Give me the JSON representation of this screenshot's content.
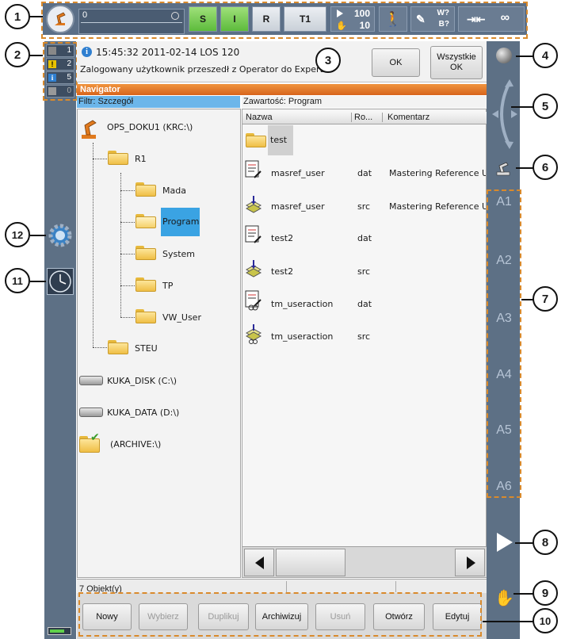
{
  "status_bar": {
    "override_value": "0",
    "btn_s": "S",
    "btn_i": "I",
    "btn_r": "R",
    "mode": "T1",
    "speed_prog": "100",
    "speed_jog": "10",
    "btn_w": "W?",
    "btn_b": "B?",
    "infinity": "∞"
  },
  "message_counters": [
    {
      "count": "1",
      "color": "#888888"
    },
    {
      "count": "2",
      "color": "#e8c200"
    },
    {
      "count": "5",
      "color": "#2f7fd0"
    },
    {
      "count": "0",
      "color": "#999999"
    }
  ],
  "message": {
    "timestamp": "15:45:32 2011-02-14 LOS 120",
    "text": "Zalogowany użytkownik przeszedł z Operator do Expert.",
    "ok_label": "OK",
    "all_ok_label": "Wszystkie\nOK"
  },
  "navigator": {
    "title": "Navigator",
    "filter_label": "Filtr: Szczegół",
    "content_label": "Zawartość: Program",
    "columns": {
      "name": "Nazwa",
      "type": "Ro...",
      "comment": "Komentarz"
    },
    "tree": {
      "root": "OPS_DOKU1 (KRC:\\)",
      "r1": "R1",
      "mada": "Mada",
      "program": "Program",
      "system": "System",
      "tp": "TP",
      "vw_user": "VW_User",
      "steu": "STEU",
      "kuka_disk": "KUKA_DISK (C:\\)",
      "kuka_data": "KUKA_DATA (D:\\)",
      "archive": "(ARCHIVE:\\)"
    },
    "files": [
      {
        "name": "test",
        "type": "",
        "comment": ""
      },
      {
        "name": "masref_user",
        "type": "dat",
        "comment": "Mastering Reference U"
      },
      {
        "name": "masref_user",
        "type": "src",
        "comment": "Mastering Reference U"
      },
      {
        "name": "test2",
        "type": "dat",
        "comment": ""
      },
      {
        "name": "test2",
        "type": "src",
        "comment": ""
      },
      {
        "name": "tm_useraction",
        "type": "dat",
        "comment": ""
      },
      {
        "name": "tm_useraction",
        "type": "src",
        "comment": ""
      }
    ],
    "status_count": "7 Objekt(y)"
  },
  "softkeys": {
    "new": "Nowy",
    "select": "Wybierz",
    "duplicate": "Duplikuj",
    "archive": "Archiwizuj",
    "delete": "Usuń",
    "open": "Otwórz",
    "edit": "Edytuj"
  },
  "axes": [
    "A1",
    "A2",
    "A3",
    "A4",
    "A5",
    "A6"
  ],
  "callouts": [
    "1",
    "2",
    "3",
    "4",
    "5",
    "6",
    "7",
    "8",
    "9",
    "10",
    "11",
    "12"
  ]
}
